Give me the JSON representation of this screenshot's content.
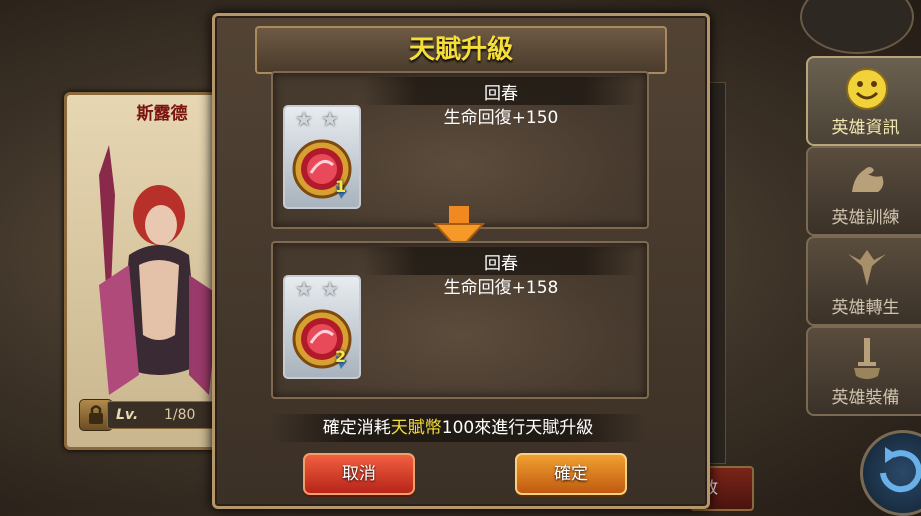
{
  "background": {
    "hero_name": "斯露德",
    "level_label": "Lv.",
    "level_value": "1/80",
    "side_menu": [
      {
        "label": "英雄資訊",
        "icon": "smiley-icon",
        "active": true
      },
      {
        "label": "英雄訓練",
        "icon": "muscle-arm-icon",
        "active": false
      },
      {
        "label": "英雄轉生",
        "icon": "phoenix-icon",
        "active": false
      },
      {
        "label": "英雄裝備",
        "icon": "sword-shield-icon",
        "active": false
      }
    ],
    "partial_button_text": "敗"
  },
  "dialog": {
    "title": "天賦升級",
    "current": {
      "name": "回春",
      "effect": "生命回復+150",
      "level": "1",
      "stars": 2
    },
    "next": {
      "name": "回春",
      "effect": "生命回復+158",
      "level": "2",
      "stars": 2
    },
    "cost": {
      "prefix": "確定消耗",
      "currency": "天賦幣",
      "suffix": "100來進行天賦升級"
    },
    "cancel_label": "取消",
    "confirm_label": "確定"
  },
  "colors": {
    "title": "#f5de3a",
    "currency_highlight": "#f5de3a",
    "cancel_button": "#d8402a",
    "confirm_button": "#e07a20"
  }
}
